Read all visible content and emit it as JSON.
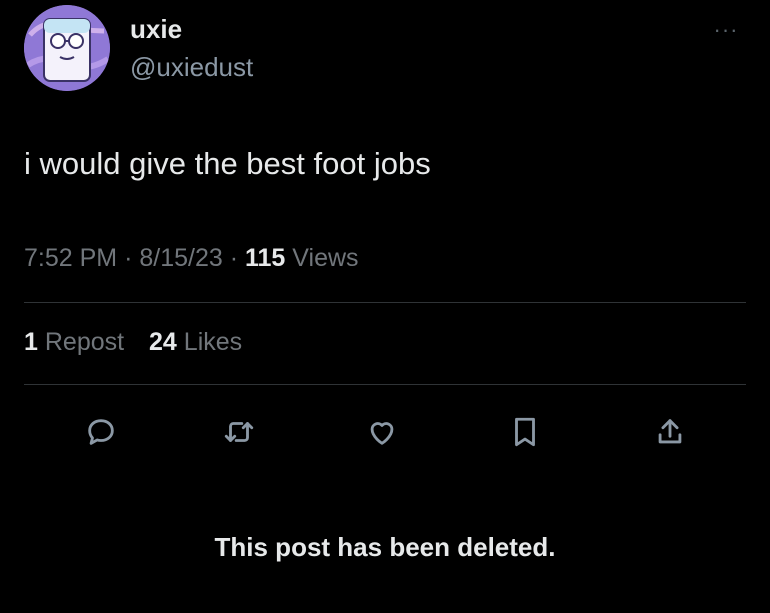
{
  "author": {
    "display_name": "uxie",
    "handle": "@uxiedust",
    "avatar_icon": "avatar-icon"
  },
  "post": {
    "text": "i would give the best foot jobs",
    "time": "7:52 PM",
    "separator": "·",
    "date": "8/15/23",
    "views_count": "115",
    "views_label": "Views"
  },
  "stats": {
    "reposts_count": "1",
    "reposts_label": "Repost",
    "likes_count": "24",
    "likes_label": "Likes"
  },
  "actions": {
    "reply_icon": "reply-icon",
    "repost_icon": "repost-icon",
    "like_icon": "heart-icon",
    "bookmark_icon": "bookmark-icon",
    "share_icon": "share-icon"
  },
  "more_label": "···",
  "deleted_notice": "This post has been deleted.",
  "colors": {
    "background": "#000000",
    "primary_text": "#e7e9ea",
    "secondary_text": "#71767b",
    "divider": "#2f3336"
  }
}
